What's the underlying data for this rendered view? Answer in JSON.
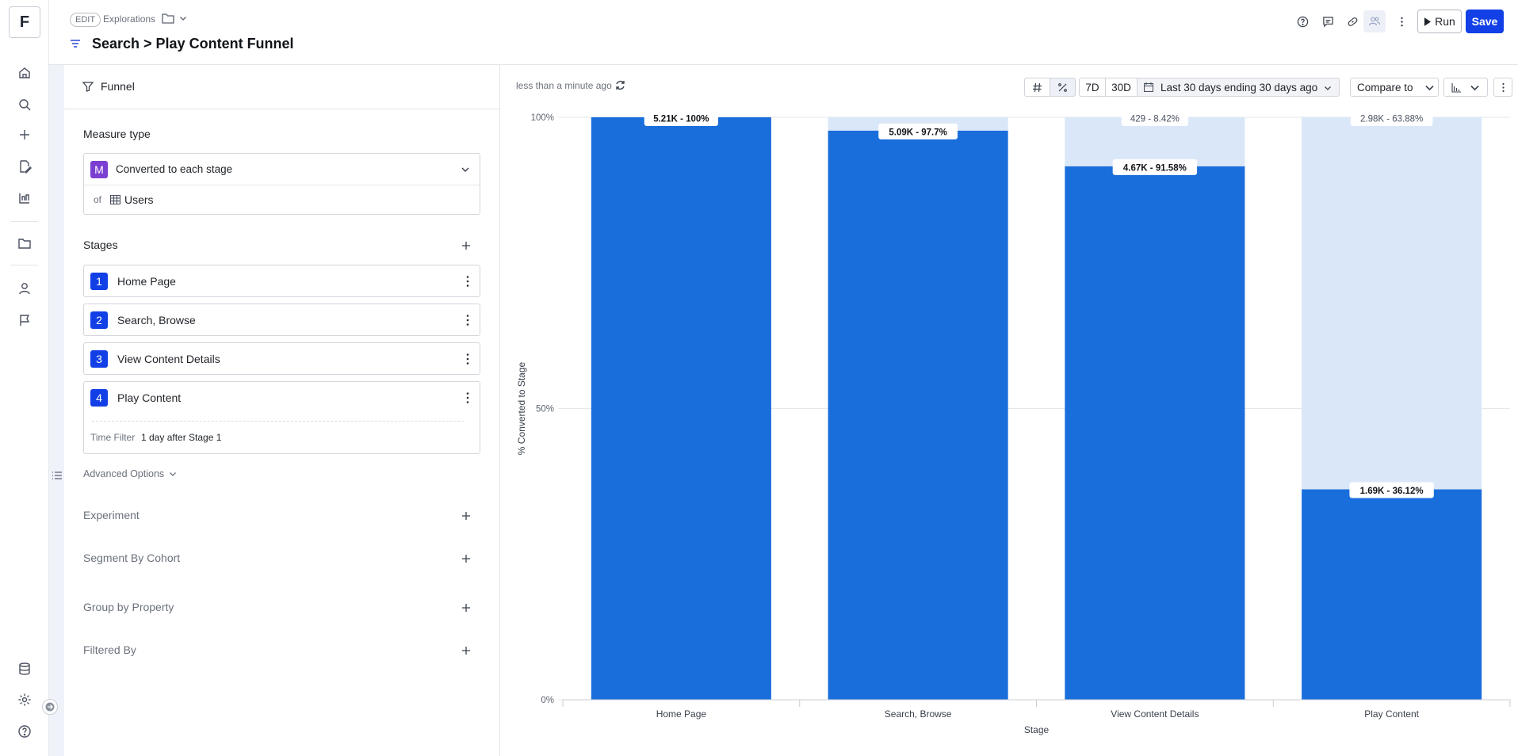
{
  "app": {
    "logo_letter": "F"
  },
  "header": {
    "edit_badge": "EDIT",
    "breadcrumb": "Explorations",
    "title": "Search > Play Content Funnel",
    "run_label": "Run",
    "save_label": "Save"
  },
  "panel": {
    "header_label": "Funnel",
    "measure_type_title": "Measure type",
    "measure_badge": "M",
    "measure_value": "Converted to each stage",
    "of_label": "of",
    "of_value": "Users",
    "stages_title": "Stages",
    "stages": [
      {
        "num": "1",
        "label": "Home Page"
      },
      {
        "num": "2",
        "label": "Search, Browse"
      },
      {
        "num": "3",
        "label": "View Content Details"
      },
      {
        "num": "4",
        "label": "Play Content"
      }
    ],
    "time_filter_label": "Time Filter",
    "time_filter_value": "1 day after Stage 1",
    "advanced_options": "Advanced Options",
    "sections": [
      "Experiment",
      "Segment By Cohort",
      "Group by Property",
      "Filtered By"
    ]
  },
  "chart_toolbar": {
    "updated": "less than a minute ago",
    "btn_7d": "7D",
    "btn_30d": "30D",
    "date_range": "Last 30 days ending 30 days ago",
    "compare": "Compare to"
  },
  "colors": {
    "accent": "#1240e6",
    "bar_converted": "#1a6edc",
    "bar_dropoff": "#d9e7f8",
    "measure_badge": "#7b3fd1"
  },
  "chart_data": {
    "type": "bar",
    "categories": [
      "Home Page",
      "Search, Browse",
      "View Content Details",
      "Play Content"
    ],
    "series": [
      {
        "values": [
          100,
          97.7,
          91.58,
          36.12
        ],
        "labels": [
          "5.21K - 100%",
          "5.09K - 97.7%",
          "4.67K - 91.58%",
          "1.69K - 36.12%"
        ]
      },
      {
        "values": [
          0,
          2.3,
          8.42,
          63.88
        ],
        "labels": [
          "",
          "",
          "429 - 8.42%",
          "2.98K - 63.88%"
        ]
      }
    ],
    "xlabel": "Stage",
    "ylabel": "% Converted to Stage",
    "ylim": [
      0,
      100
    ],
    "yticks": [
      "0%",
      "50%",
      "100%"
    ],
    "stacked": true
  }
}
